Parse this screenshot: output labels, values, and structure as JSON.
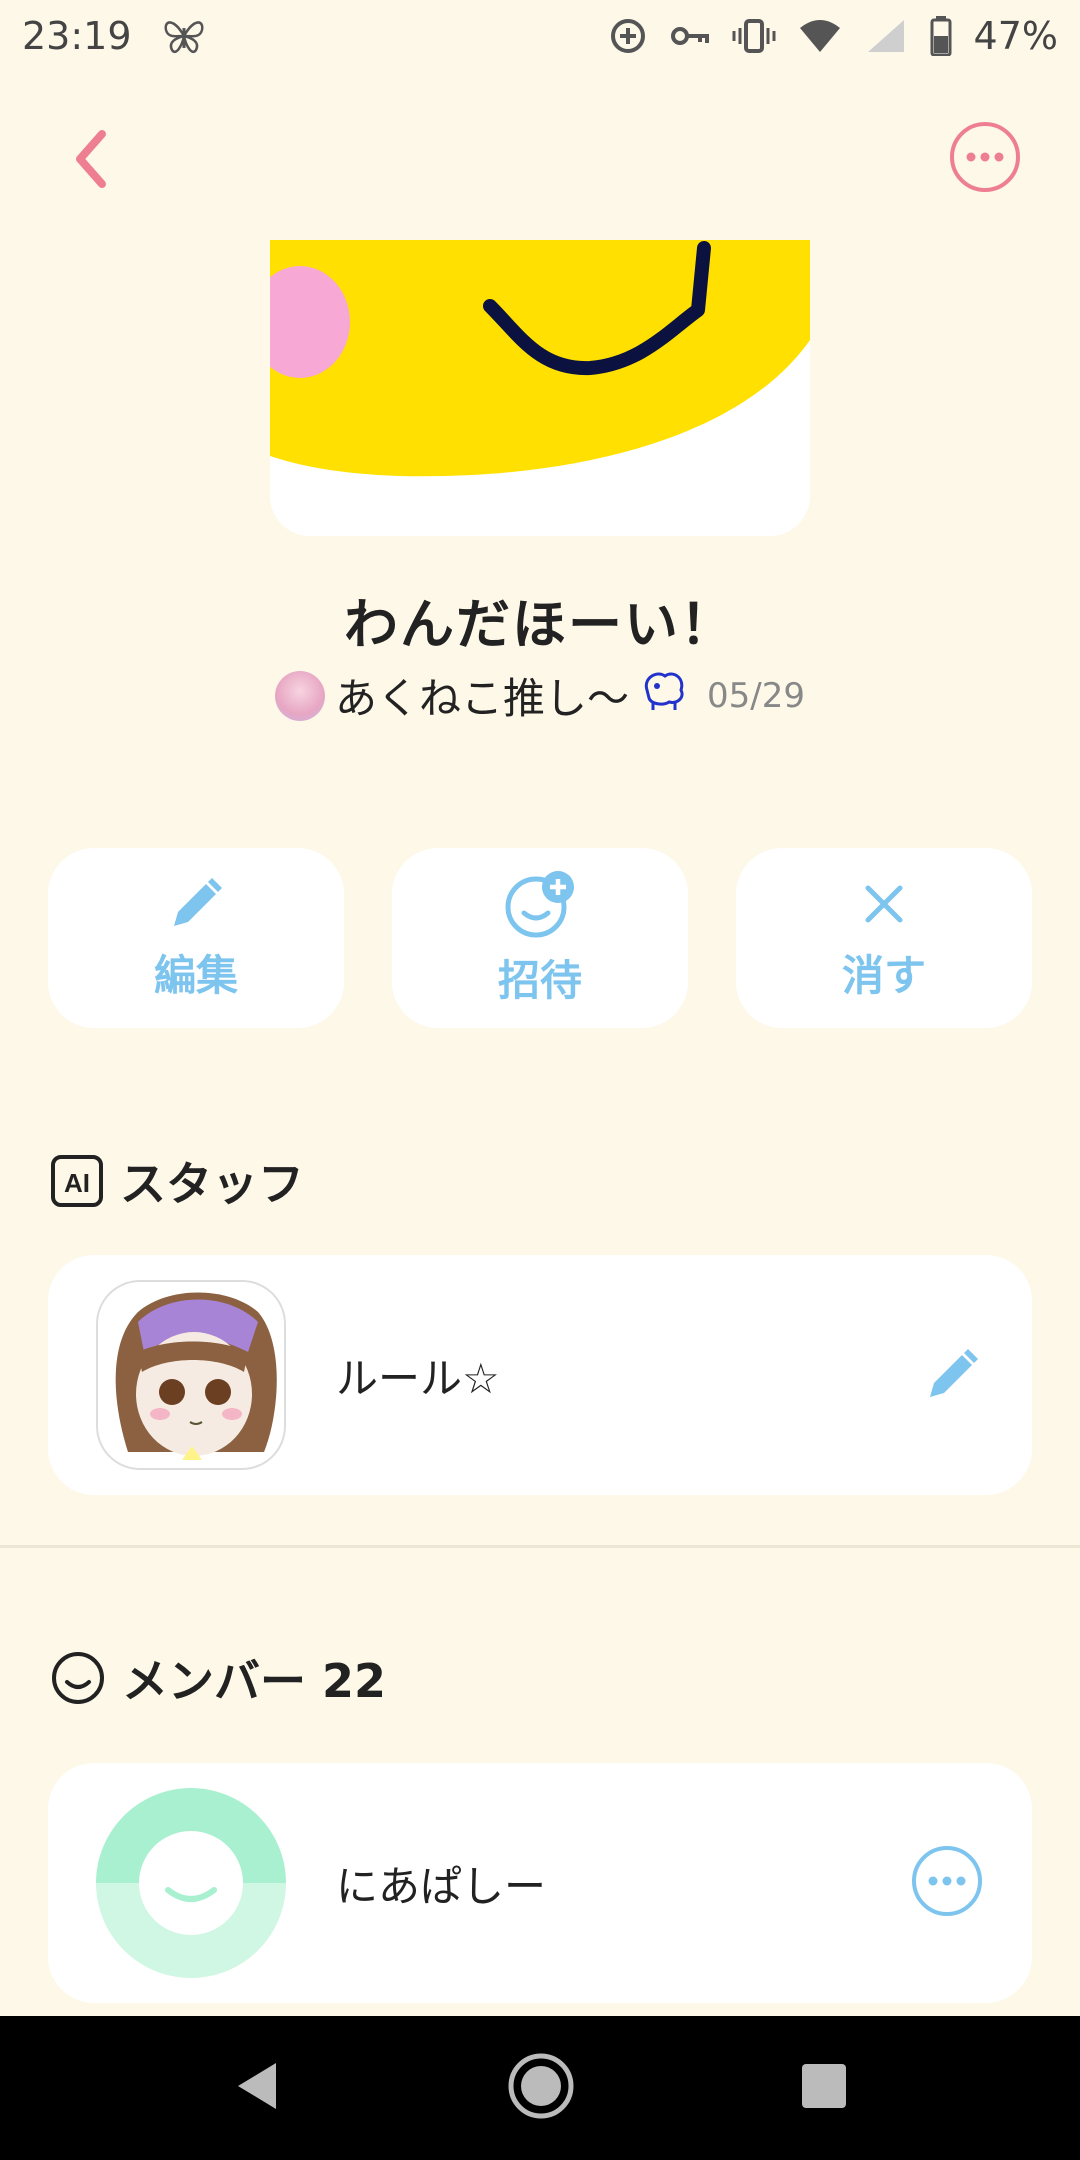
{
  "status_bar": {
    "time": "23:19",
    "battery": "47%",
    "icons": [
      "butterfly-icon",
      "data-saver-icon",
      "vpn-key-icon",
      "vibrate-icon",
      "wifi-icon",
      "signal-icon",
      "battery-icon"
    ]
  },
  "header": {
    "back_icon": "chevron-left-icon",
    "more_icon": "ellipsis-circle-icon"
  },
  "group": {
    "title": "わんだほーい！",
    "owner_name": "あくねこ推し〜",
    "date": "05/29"
  },
  "actions": [
    {
      "label": "編集",
      "icon": "pencil-icon"
    },
    {
      "label": "招待",
      "icon": "add-smiley-icon"
    },
    {
      "label": "消す",
      "icon": "close-icon"
    }
  ],
  "staff_section": {
    "badge": "AI",
    "title": "スタッフ",
    "items": [
      {
        "name": "ルール☆",
        "edit_icon": "pencil-icon"
      }
    ]
  },
  "members_section": {
    "title": "メンバー 22",
    "items": [
      {
        "name": "にあぱしー",
        "more_icon": "ellipsis-circle-icon"
      }
    ]
  },
  "colors": {
    "background": "#fdf8e8",
    "accent_pink": "#ee7f91",
    "accent_blue": "#7dc4ee",
    "cover_yellow": "#ffe000"
  }
}
